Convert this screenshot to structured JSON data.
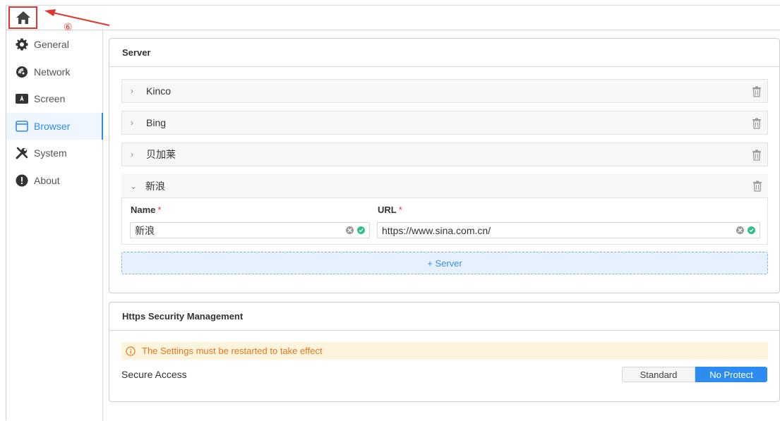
{
  "annotation": {
    "marker": "⑥",
    "color": "#e0372f"
  },
  "sidebar": {
    "accent": "#2c8af5",
    "items": [
      {
        "label": "General",
        "icon": "gear-icon",
        "active": false
      },
      {
        "label": "Network",
        "icon": "network-icon",
        "active": false
      },
      {
        "label": "Screen",
        "icon": "screen-icon",
        "active": false
      },
      {
        "label": "Browser",
        "icon": "browser-icon",
        "active": true
      },
      {
        "label": "System",
        "icon": "tools-icon",
        "active": false
      },
      {
        "label": "About",
        "icon": "info-icon",
        "active": false
      }
    ]
  },
  "server_panel": {
    "title": "Server",
    "servers": [
      {
        "name": "Kinco",
        "expanded": false
      },
      {
        "name": "Bing",
        "expanded": false
      },
      {
        "name": "贝加莱",
        "expanded": false
      },
      {
        "name": "新浪",
        "expanded": true
      }
    ],
    "form": {
      "name_label": "Name",
      "url_label": "URL",
      "required_mark": "*",
      "name_value": "新浪",
      "url_value": "https://www.sina.com.cn/"
    },
    "add_label": "+ Server"
  },
  "https_panel": {
    "title": "Https Security Management",
    "warning": "The Settings must be restarted to take effect",
    "secure_label": "Secure Access",
    "options": [
      "Standard",
      "No Protect"
    ],
    "selected": "No Protect"
  }
}
